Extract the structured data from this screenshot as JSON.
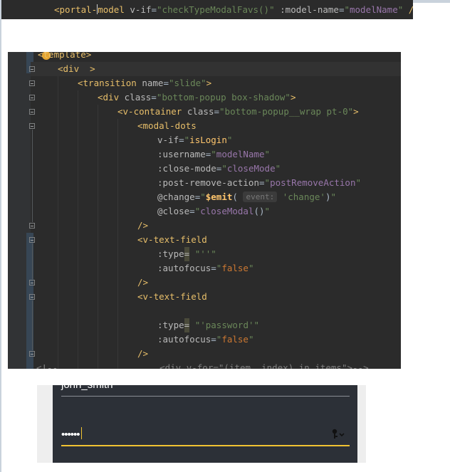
{
  "top_snippet": {
    "tag_open": "<portal-",
    "tag_rest": "model",
    "attr1": "v-if",
    "val1": "\"checkTypeModalFavs()\"",
    "attr2": ":model-name",
    "val2_q1": "\"",
    "val2": "modelName",
    "val2_q2": "\"",
    "close": "/>"
  },
  "editor": {
    "lines": [
      {
        "t": "template_partial",
        "text": "<template>"
      },
      {
        "t": "div_open",
        "text": "<div"
      },
      {
        "t": "transition",
        "tag": "<transition",
        "attr": "name",
        "val": "\"slide\"",
        "close": ">"
      },
      {
        "t": "div_class",
        "tag": "<div",
        "attr": "class",
        "val": "\"bottom-popup box-shadow\"",
        "close": ">"
      },
      {
        "t": "vcontainer",
        "tag": "<v-container",
        "attr": "class",
        "val": "\"bottom-popup__wrap pt-0\"",
        "close": ">"
      },
      {
        "t": "modal_dots",
        "tag": "<modal-dots"
      },
      {
        "t": "vif",
        "attr": "v-if",
        "val": "isLogin"
      },
      {
        "t": "username",
        "attr": ":username",
        "val": "modelName"
      },
      {
        "t": "closemode",
        "attr": ":close-mode",
        "val": "closeMode"
      },
      {
        "t": "postremove",
        "attr": ":post-remove-action",
        "val": "postRemoveAction"
      },
      {
        "t": "change",
        "attr": "@change",
        "fn": "$emit",
        "hint": "event:",
        "arg": "'change'"
      },
      {
        "t": "close",
        "attr": "@close",
        "val": "closeModal",
        "parens": "()"
      },
      {
        "t": "selfclose",
        "text": "/>"
      },
      {
        "t": "vtext1",
        "tag": "<v-text-field"
      },
      {
        "t": "type1",
        "attr": ":type",
        "eq": "=",
        "val": "''"
      },
      {
        "t": "autofocus1",
        "attr": ":autofocus",
        "val": "false"
      },
      {
        "t": "selfclose2",
        "text": "/>"
      },
      {
        "t": "vtext2",
        "tag": "<v-text-field"
      },
      {
        "t": "blank",
        "text": ""
      },
      {
        "t": "type2",
        "attr": ":type",
        "eq": "=",
        "val": "'password'"
      },
      {
        "t": "autofocus2",
        "attr": ":autofocus",
        "val": "false"
      },
      {
        "t": "selfclose3",
        "text": "/>"
      },
      {
        "t": "comment",
        "text": "<!--                   <div v-for=\"(item, index) in items\">-->"
      }
    ]
  },
  "preview": {
    "username_value": "john_smith",
    "password_value": "••••••",
    "icon": "key-visibility-icon"
  },
  "colors": {
    "editor_bg": "#2b2b2b",
    "tag": "#e8bf6a",
    "string": "#6a8759",
    "variable": "#9876aa",
    "accent_yellow": "#f1c232",
    "preview_bg": "#2c3037"
  }
}
